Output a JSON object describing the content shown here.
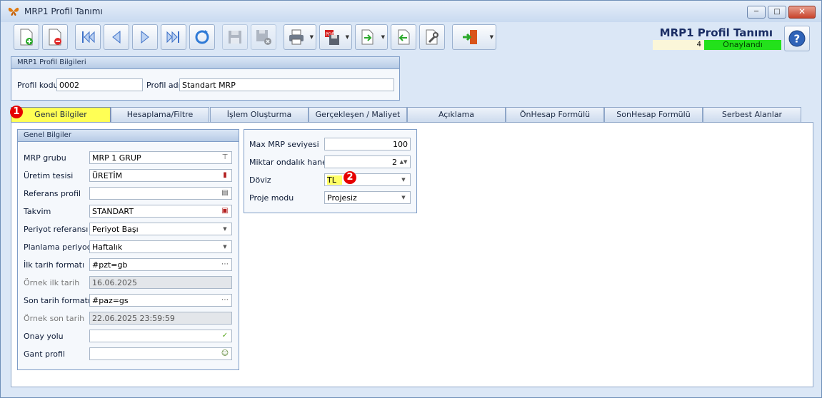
{
  "window": {
    "title": "MRP1 Profil Tanımı"
  },
  "header": {
    "title": "MRP1 Profil Tanımı",
    "record_no": "4",
    "status": "Onaylandı",
    "status_color": "#23e11b"
  },
  "toolbar": {
    "buttons": [
      "new-document-icon",
      "delete-document-icon",
      "first-record-icon",
      "previous-record-icon",
      "next-record-icon",
      "last-record-icon",
      "refresh-icon",
      "save-icon",
      "save-close-icon",
      "print-icon",
      "pdf-export-icon",
      "export-icon",
      "import-icon",
      "settings-tool-icon",
      "exit-door-icon"
    ]
  },
  "profile_info": {
    "group_title": "MRP1 Profil Bilgileri",
    "code_label": "Profil kodu",
    "code_value": "0002",
    "name_label": "Profil adı",
    "name_value": "Standart MRP"
  },
  "tabs": [
    {
      "label": "Genel Bilgiler",
      "active": true
    },
    {
      "label": "Hesaplama/Filtre"
    },
    {
      "label": "İşlem Oluşturma"
    },
    {
      "label": "Gerçekleşen / Maliyet"
    },
    {
      "label": "Açıklama"
    },
    {
      "label": "ÖnHesap Formülü"
    },
    {
      "label": "SonHesap Formülü"
    },
    {
      "label": "Serbest Alanlar"
    }
  ],
  "general": {
    "group_title": "Genel Bilgiler",
    "fields": [
      {
        "label": "MRP grubu",
        "value": "MRP 1 GRUP"
      },
      {
        "label": "Üretim tesisi",
        "value": "ÜRETİM"
      },
      {
        "label": "Referans profil",
        "value": ""
      },
      {
        "label": "Takvim",
        "value": "STANDART"
      },
      {
        "label": "Periyot referansı",
        "value": "Periyot Başı"
      },
      {
        "label": "Planlama periyodu",
        "value": "Haftalık"
      },
      {
        "label": "İlk tarih formatı",
        "value": "#pzt=gb"
      },
      {
        "label": "Örnek ilk tarih",
        "value": "16.06.2025"
      },
      {
        "label": "Son tarih formatı",
        "value": "#paz=gs"
      },
      {
        "label": "Örnek son tarih",
        "value": "22.06.2025 23:59:59"
      },
      {
        "label": "Onay yolu",
        "value": ""
      },
      {
        "label": "Gant profil",
        "value": ""
      }
    ]
  },
  "mrp_settings": {
    "fields": [
      {
        "label": "Max MRP seviyesi",
        "value": "100"
      },
      {
        "label": "Miktar ondalık hanesi",
        "value": "2"
      },
      {
        "label": "Döviz",
        "value": "TL"
      },
      {
        "label": "Proje modu",
        "value": "Projesiz"
      }
    ]
  },
  "annotations": {
    "marker1": "1",
    "marker2": "2"
  }
}
